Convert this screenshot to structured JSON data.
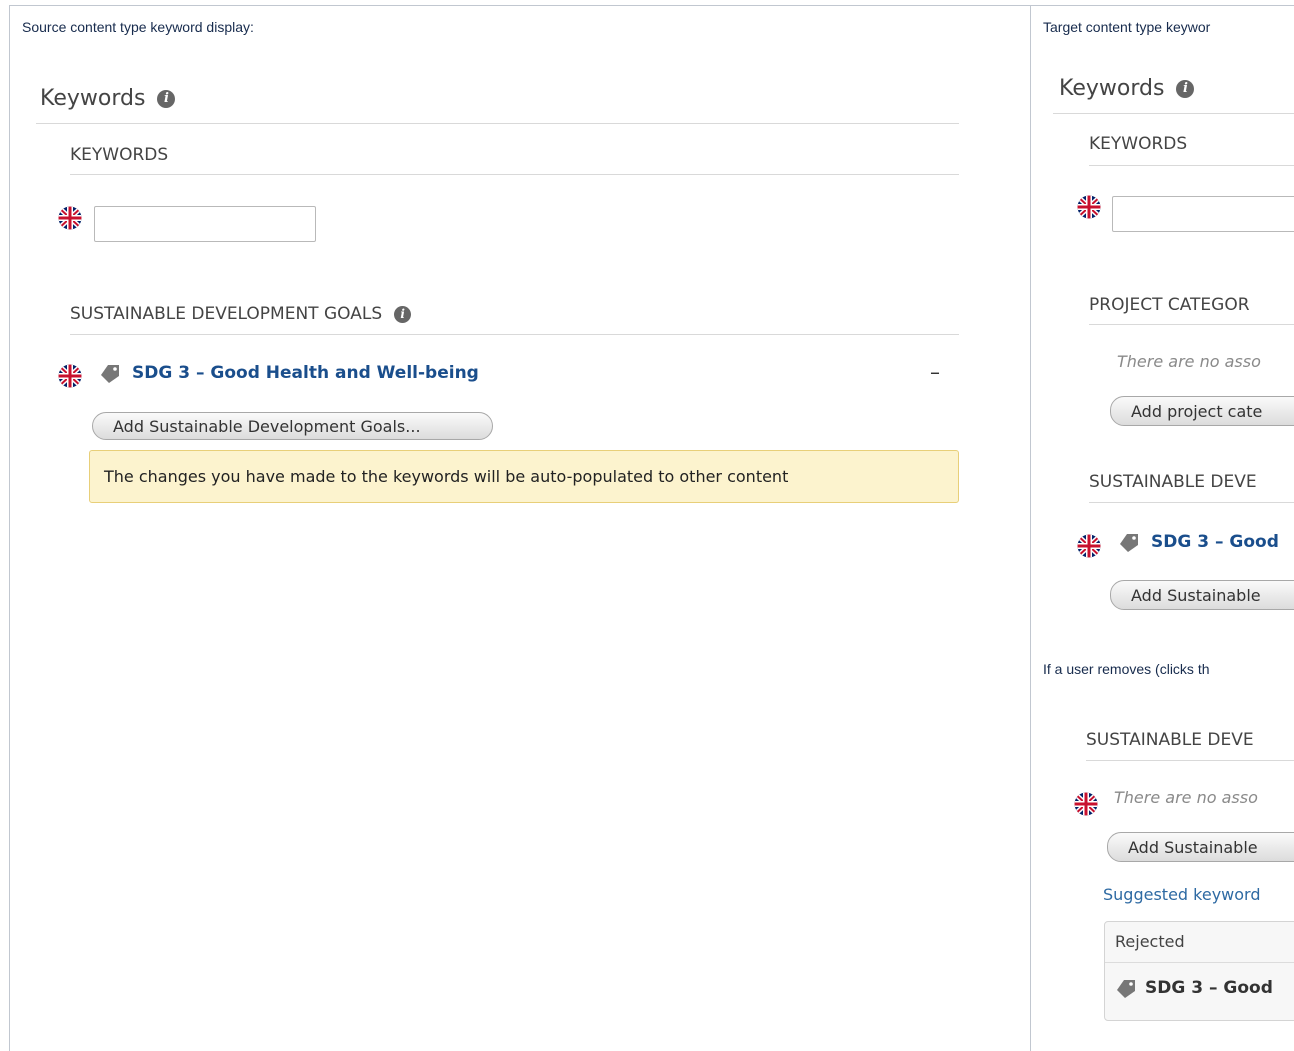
{
  "left": {
    "caption": "Source content type keyword display:",
    "keywords_title": "Keywords",
    "keywords_heading": "KEYWORDS",
    "sdg_heading": "SUSTAINABLE DEVELOPMENT GOALS",
    "sdg_item": "SDG 3 – Good Health and Well-being",
    "remove_symbol": "–",
    "add_sdg_button": "Add Sustainable Development Goals...",
    "notice": "The changes you have made to the keywords will be auto-populated to other content"
  },
  "right": {
    "caption": "Target content type keywor",
    "keywords_title": "Keywords",
    "keywords_heading": "KEYWORDS",
    "project_heading": "PROJECT CATEGOR",
    "project_empty": "There are no asso",
    "add_project_button": "Add project cate",
    "sdg_heading": "SUSTAINABLE DEVE",
    "sdg_item": "SDG 3 – Good",
    "add_sdg_button": "Add Sustainable",
    "remove_note": "If a user removes (clicks th",
    "sdg_heading_2": "SUSTAINABLE DEVE",
    "sdg_empty": "There are no asso",
    "add_sdg_button_2": "Add Sustainable",
    "suggested": "Suggested keyword",
    "rejected_label": "Rejected",
    "rejected_item": "SDG 3 – Good"
  },
  "icons": {
    "info": "info-icon",
    "flag": "uk-flag-icon",
    "tag": "tag-icon"
  },
  "colors": {
    "link": "#1a4e8c",
    "notice_bg": "#fcf3ce",
    "notice_border": "#e8cf79",
    "suggested_link": "#2e6aa3"
  }
}
